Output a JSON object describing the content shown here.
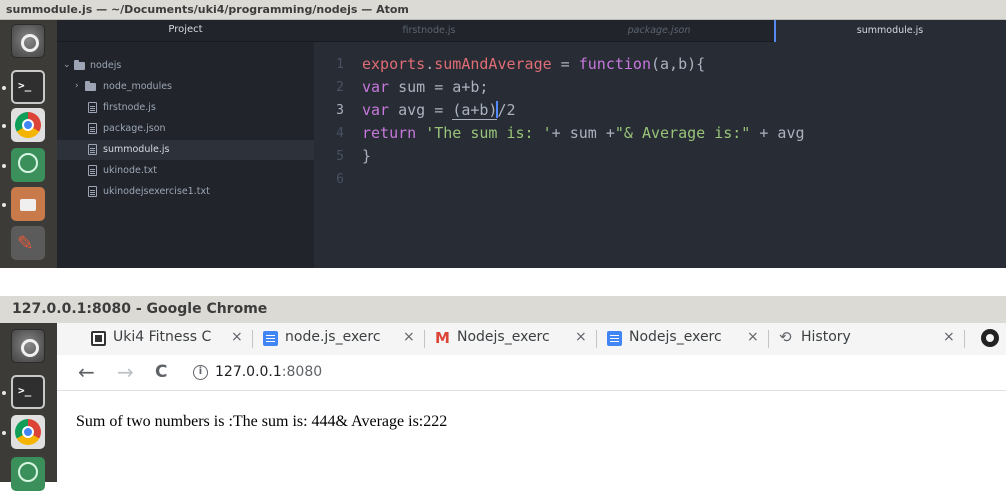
{
  "atom": {
    "title": "summodule.js — ~/Documents/uki4/programming/nodejs — Atom",
    "tree": {
      "header": "Project",
      "items": [
        {
          "label": "nodejs",
          "kind": "folder",
          "expanded": true
        },
        {
          "label": "node_modules",
          "kind": "folder",
          "expanded": false
        },
        {
          "label": "firstnode.js",
          "kind": "file"
        },
        {
          "label": "package.json",
          "kind": "file"
        },
        {
          "label": "summodule.js",
          "kind": "file",
          "selected": true
        },
        {
          "label": "ukinode.txt",
          "kind": "file"
        },
        {
          "label": "ukinodejsexercise1.txt",
          "kind": "file"
        }
      ]
    },
    "tabs": [
      {
        "label": "firstnode.js",
        "active": false
      },
      {
        "label": "package.json",
        "active": false
      },
      {
        "label": "summodule.js",
        "active": true
      }
    ],
    "line_numbers": [
      "1",
      "2",
      "3",
      "4",
      "5",
      "6"
    ],
    "current_line": "3",
    "code": {
      "l1_obj": "exports",
      "l1_dot": ".",
      "l1_prop": "sumAndAverage",
      "l1_eq": " = ",
      "l1_fn": "function",
      "l1_args": "(a,b){",
      "l2_kw": "var",
      "l2_rest": " sum = a+b;",
      "l3_kw": "var",
      "l3_a": " avg = ",
      "l3_paren": "(a+b)",
      "l3_b": "/2",
      "l4_kw": "return",
      "l4_s1": "'The sum is: '",
      "l4_mid": "+ sum +",
      "l4_s2": "\"& Average is:\"",
      "l4_end": " + avg",
      "l5": "}"
    }
  },
  "chrome": {
    "title": "127.0.0.1:8080 - Google Chrome",
    "tabs": [
      {
        "title": "Uki4 Fitness C",
        "fade": ""
      },
      {
        "title": "node.js_exerc",
        "fade": ""
      },
      {
        "title": "Nodejs_exerc",
        "fade": ""
      },
      {
        "title": "Nodejs_exerc",
        "fade": ""
      },
      {
        "title": "History",
        "fade": ""
      }
    ],
    "close_glyph": "×",
    "nav": {
      "back": "←",
      "forward": "→",
      "reload": "C"
    },
    "info_glyph": "i",
    "url_host": "127.0.0.1",
    "url_port": ":8080",
    "page_text": "Sum of two numbers is :The sum is: 444& Average is:222"
  },
  "launcher_icons": [
    "dash-icon",
    "terminal-icon",
    "chrome-icon",
    "atom-icon",
    "files-icon",
    "settings-icon"
  ]
}
